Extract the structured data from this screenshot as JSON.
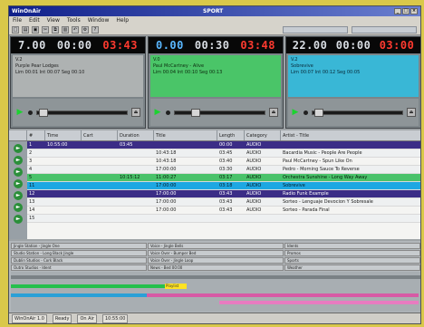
{
  "app": {
    "window_title": "WinOnAir",
    "center_title": "SPORT"
  },
  "menu": [
    "File",
    "Edit",
    "View",
    "Tools",
    "Window",
    "Help"
  ],
  "toolbar": {
    "icons": [
      "new-icon",
      "open-icon",
      "save-icon",
      "cut-icon",
      "copy-icon",
      "paste-icon",
      "undo-icon",
      "settings-icon",
      "help-icon"
    ]
  },
  "players": [
    {
      "color": "#aeb2b2",
      "counters": [
        "7.00",
        "00:00",
        "03:43"
      ],
      "title": "Purple Pear Lodges",
      "label_small": "V.2",
      "lines": [
        "Lim 00:01",
        "Int 00:07",
        "Seg 00:10"
      ]
    },
    {
      "color": "#4ac568",
      "counters": [
        "0.00",
        "00:30",
        "03:48"
      ],
      "title": "Paul McCartney - Alive",
      "label_small": "V.0",
      "lines": [
        "Lim 00:04",
        "Int 00:10",
        "Seg 00:13"
      ]
    },
    {
      "color": "#39b7d6",
      "counters": [
        "22.00",
        "00:00",
        "03:00"
      ],
      "title": "Sobrevive",
      "label_small": "V.2",
      "lines": [
        "Lim 00:07",
        "Int 00:12",
        "Seg 00:05"
      ]
    }
  ],
  "playlist": {
    "headers": [
      "#",
      "Time",
      "Cart",
      "Duration",
      "Title",
      "Length",
      "Category",
      "Artist - Title"
    ],
    "rows": [
      {
        "style": "purple",
        "num": "1",
        "time": "10:55:00",
        "cart": "",
        "dur": "03:45",
        "title": "",
        "len": "00:00",
        "cat": "AUDIO",
        "info": ""
      },
      {
        "style": "alt",
        "num": "2",
        "time": "",
        "cart": "",
        "dur": "",
        "title": "10:43:18",
        "len": "03:45",
        "cat": "AUDIO",
        "info": "Bacardia Music - People Are People"
      },
      {
        "style": "",
        "num": "3",
        "time": "",
        "cart": "",
        "dur": "",
        "title": "10:43:18",
        "len": "03:40",
        "cat": "AUDIO",
        "info": "Paul McCartney - Spun Like On"
      },
      {
        "style": "alt",
        "num": "4",
        "time": "",
        "cart": "",
        "dur": "",
        "title": "17:00:00",
        "len": "03:30",
        "cat": "AUDIO",
        "info": "Pedro - Morning Sauce To Reverse"
      },
      {
        "style": "green",
        "num": "5",
        "time": "",
        "cart": "",
        "dur": "10:15:12",
        "title": "11:00:27",
        "len": "03:17",
        "cat": "AUDIO",
        "info": "Orchestra Sunshine - Long Way Away"
      },
      {
        "style": "blue",
        "num": "11",
        "time": "",
        "cart": "",
        "dur": "",
        "title": "17:00:00",
        "len": "03:18",
        "cat": "AUDIO",
        "info": "Sobrevive"
      },
      {
        "style": "purple",
        "num": "12",
        "time": "",
        "cart": "",
        "dur": "",
        "title": "17:00:00",
        "len": "03:43",
        "cat": "AUDIO",
        "info": "Radio Funk Example"
      },
      {
        "style": "alt",
        "num": "13",
        "time": "",
        "cart": "",
        "dur": "",
        "title": "17:00:00",
        "len": "03:43",
        "cat": "AUDIO",
        "info": "Sorteo - Lenguaje Devocion Y Sobresale"
      },
      {
        "style": "",
        "num": "14",
        "time": "",
        "cart": "",
        "dur": "",
        "title": "17:00:00",
        "len": "03:43",
        "cat": "AUDIO",
        "info": "Sorteo - Parada Final"
      },
      {
        "style": "alt",
        "num": "15",
        "time": "",
        "cart": "",
        "dur": "",
        "title": "",
        "len": "",
        "cat": "",
        "info": ""
      }
    ]
  },
  "carts": [
    "Jingle Station - Jingle One",
    "Voice - Jingle Bells",
    "Idents",
    "Studio Station - Long Black Jingle",
    "Voice Over - Bumper Bed",
    "Promos",
    "Dublin Studios - Cork Black",
    "Voice Over - Jingle Loop",
    "Sports",
    "Outro Studios - Ident",
    "News - Bed 00:00",
    "Weather"
  ],
  "timeline": {
    "yellow_label": "Playlist"
  },
  "status": [
    "WinOnAir 1.0",
    "Ready",
    "On Air",
    "10:55:00"
  ]
}
